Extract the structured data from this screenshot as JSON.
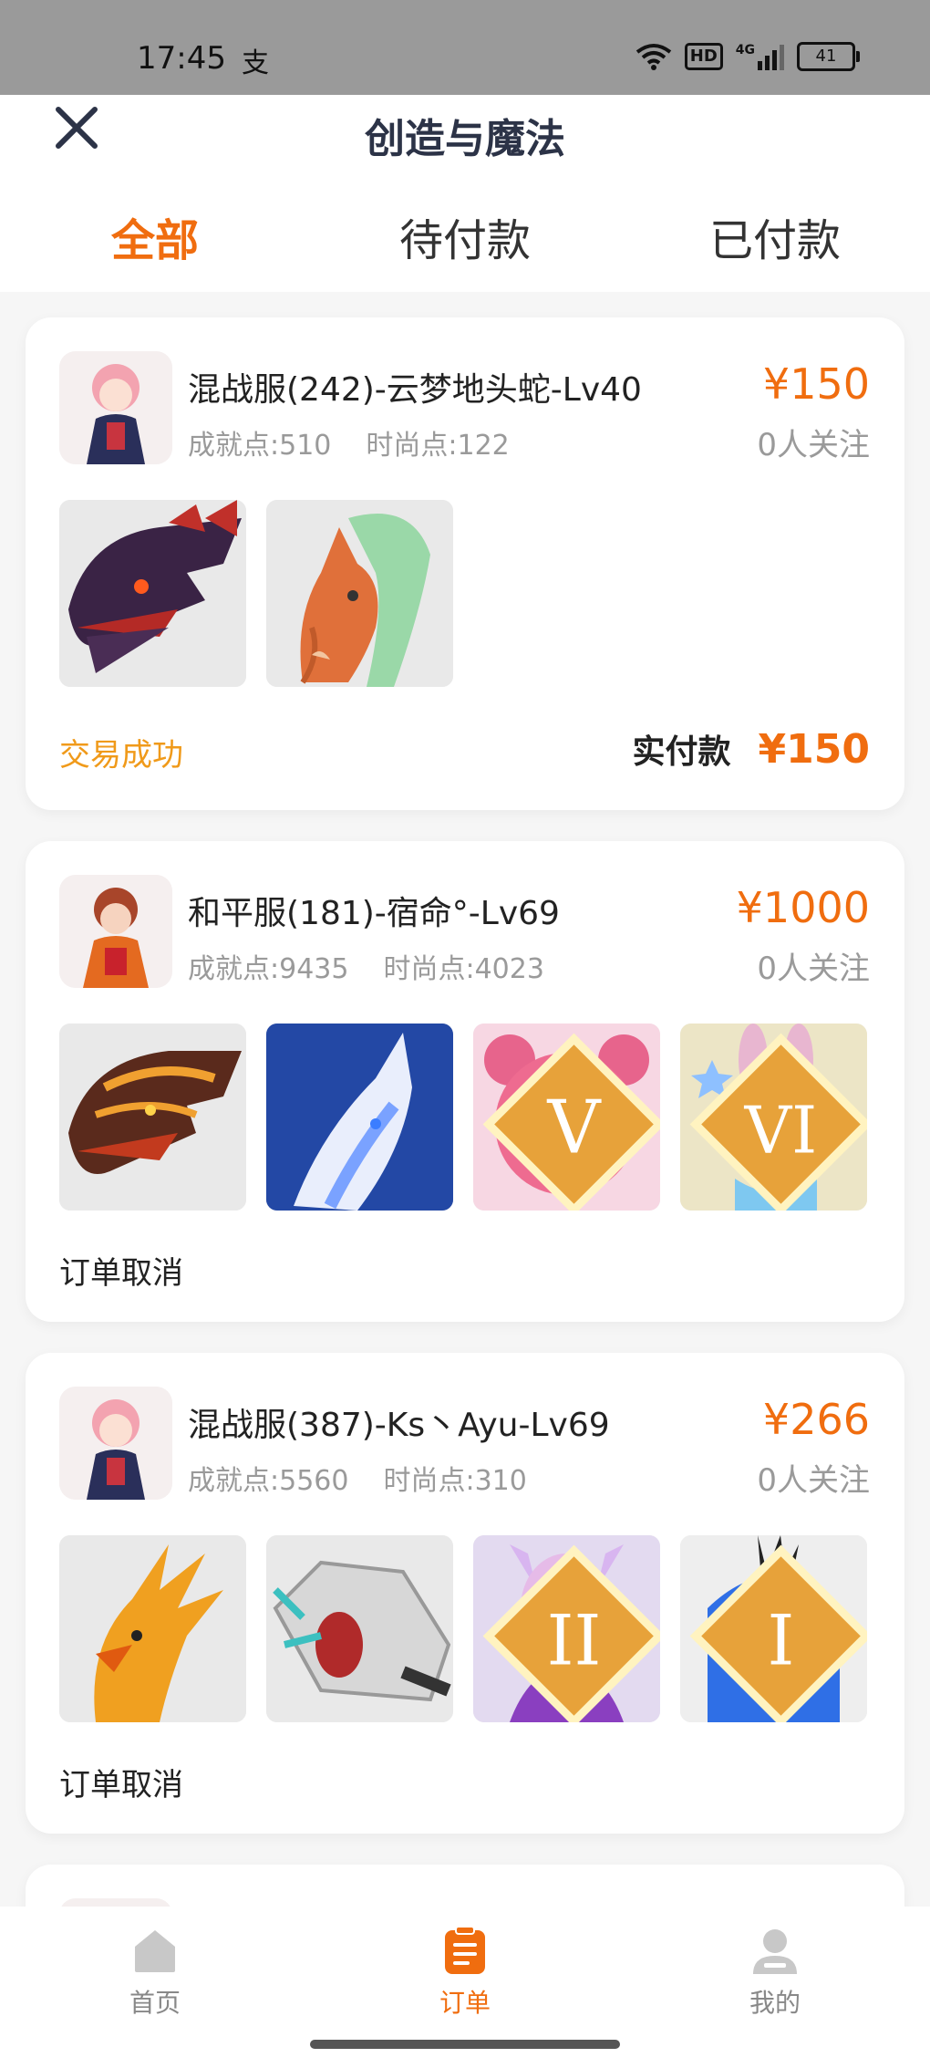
{
  "status_bar": {
    "time": "17:45",
    "app_icon": "支",
    "hd": "HD",
    "network": "4G",
    "battery": "41"
  },
  "header": {
    "title": "创造与魔法",
    "close_icon": "close-icon"
  },
  "tabs": [
    {
      "label": "全部",
      "active": true
    },
    {
      "label": "待付款",
      "active": false
    },
    {
      "label": "已付款",
      "active": false
    }
  ],
  "orders": [
    {
      "server": "混战服(242)-云梦地头蛇-Lv40",
      "achievement": "成就点:510",
      "fashion": "时尚点:122",
      "price": "¥150",
      "follows": "0人关注",
      "status": "交易成功",
      "paid_label": "实付款",
      "paid_amount": "¥150",
      "pets": [
        "dark-dragon",
        "orange-horse"
      ]
    },
    {
      "server": "和平服(181)-宿命°-Lv69",
      "achievement": "成就点:9435",
      "fashion": "时尚点:4023",
      "price": "¥1000",
      "follows": "0人关注",
      "status": "订单取消",
      "pets": [
        "fire-dragon",
        "blue-wolf",
        "pink-bear",
        "rabbit"
      ],
      "tiers": [
        "",
        "",
        "V",
        "VI"
      ]
    },
    {
      "server": "混战服(387)-Ks丶Ayu-Lv69",
      "achievement": "成就点:5560",
      "fashion": "时尚点:310",
      "price": "¥266",
      "follows": "0人关注",
      "status": "订单取消",
      "pets": [
        "phoenix",
        "mecha-dragon",
        "fox-girl",
        "blue-bird"
      ],
      "tiers": [
        "",
        "",
        "II",
        "I"
      ]
    }
  ],
  "bottom_nav": [
    {
      "label": "首页",
      "icon": "home-icon",
      "active": false
    },
    {
      "label": "订单",
      "icon": "clipboard-icon",
      "active": true
    },
    {
      "label": "我的",
      "icon": "user-icon",
      "active": false
    }
  ],
  "colors": {
    "accent": "#f06d0f",
    "success": "#f09a1a"
  }
}
